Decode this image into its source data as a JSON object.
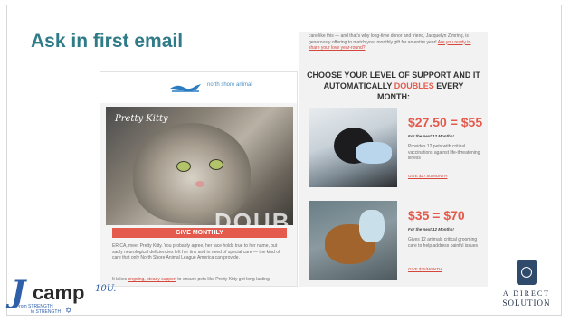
{
  "slide": {
    "title": "Ask in first email"
  },
  "left_email": {
    "logo_text": "north shore animal",
    "photo_caption": "Pretty Kitty",
    "photo_overlay": "DOUB",
    "give_button": "GIVE MONTHLY",
    "body_1": "ERICA, meet Pretty Kitty. You probably agree, her face holds true to her name, but sadly neurological deficiencies left her tiny and in need of special care — the kind of care that only North Shore Animal League America can provide.",
    "body_2_pre": "It takes ",
    "body_2_link": "ongoing, steady support",
    "body_2_post": " to ensure pets like Pretty Kitty get long-lasting"
  },
  "right_email": {
    "top_text_pre": "care like this — and that's why long-time donor and friend, Jacquelyn Zimring, is generously offering to match your monthly gift for an entire year! ",
    "top_text_link": "Are you ready to share your love year-round?",
    "choose_line1": "CHOOSE YOUR LEVEL OF SUPPORT AND IT",
    "choose_line2_pre": "AUTOMATICALLY ",
    "choose_line2_emph": "DOUBLES",
    "choose_line2_post": " EVERY",
    "choose_line3": "MONTH:",
    "tiers": [
      {
        "price": "$27.50 = $55",
        "subtitle": "For the next 12 Months!",
        "description": "Provides 12 pets with critical vaccinations against life-threatening illness",
        "link": "GIVE $27.50/MONTH"
      },
      {
        "price": "$35 = $70",
        "subtitle": "For the next 12 Months!",
        "description": "Gives 12 animals critical grooming care to help address painful issues",
        "link": "GIVE $35/MONTH"
      }
    ]
  },
  "footer": {
    "jcamp_j": "J",
    "jcamp_camp": "camp",
    "jcamp_sup": "10U.",
    "jcamp_sub1": "From STRENGTH",
    "jcamp_sub2": "to STRENGTH",
    "ads_line1": "A DIRECT",
    "ads_line2": "SOLUTION"
  },
  "colors": {
    "title": "#2f7b88",
    "accent_red": "#e45a4d",
    "brand_blue": "#2e5fa8"
  }
}
